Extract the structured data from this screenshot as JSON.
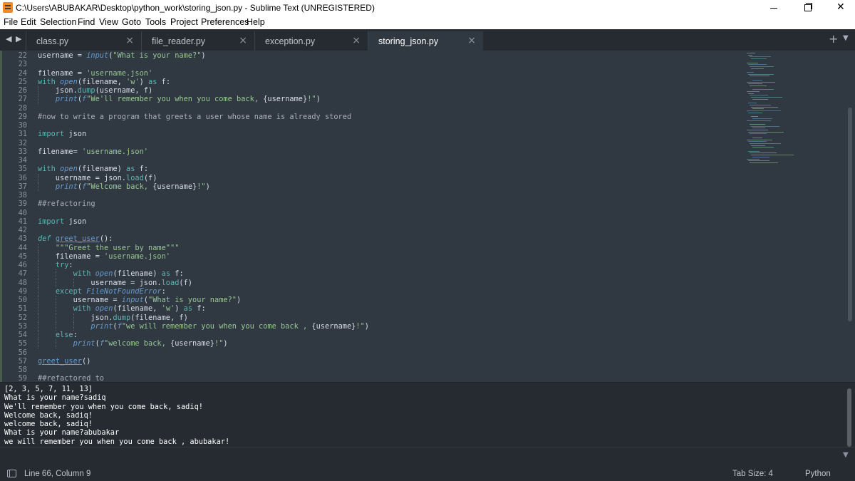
{
  "window": {
    "title": "C:\\Users\\ABUBAKAR\\Desktop\\python_work\\storing_json.py - Sublime Text (UNREGISTERED)",
    "close_glyph": "✕"
  },
  "menu": [
    "File",
    "Edit",
    "Selection",
    "Find",
    "View",
    "Goto",
    "Tools",
    "Project",
    "Preferences",
    "Help"
  ],
  "tabs": {
    "prev_glyph": "◀",
    "next_glyph": "▶",
    "items": [
      {
        "label": "class.py",
        "close": "×"
      },
      {
        "label": "file_reader.py",
        "close": "×"
      },
      {
        "label": "exception.py",
        "close": "×"
      },
      {
        "label": "storing_json.py",
        "close": "×",
        "active": true
      }
    ],
    "add_glyph": "+",
    "more_glyph": "▼"
  },
  "editor": {
    "line_numbers": [
      "22",
      "23",
      "24",
      "25",
      "26",
      "27",
      "28",
      "29",
      "30",
      "31",
      "32",
      "33",
      "34",
      "35",
      "36",
      "37",
      "38",
      "39",
      "40",
      "41",
      "42",
      "43",
      "44",
      "45",
      "46",
      "47",
      "48",
      "49",
      "50",
      "51",
      "52",
      "53",
      "54",
      "55",
      "56",
      "57",
      "58",
      "59"
    ]
  },
  "output": {
    "lines": [
      "[2, 3, 5, 7, 11, 13]",
      "What is your name?sadiq",
      "We'll remember you when you come back, sadiq!",
      "Welcome back, sadiq!",
      "welcome back, sadiq!",
      "What is your name?abubakar",
      "we will remember you when you come back , abubakar!"
    ],
    "arrow_glyph": "▼"
  },
  "status": {
    "position": "Line 66, Column 9",
    "tab_size": "Tab Size: 4",
    "syntax": "Python"
  },
  "colors": {
    "editor_bg": "#303841",
    "panel_bg": "#252b31",
    "keyword": "#5fb4b4",
    "string": "#99c794",
    "function": "#6699cc"
  }
}
